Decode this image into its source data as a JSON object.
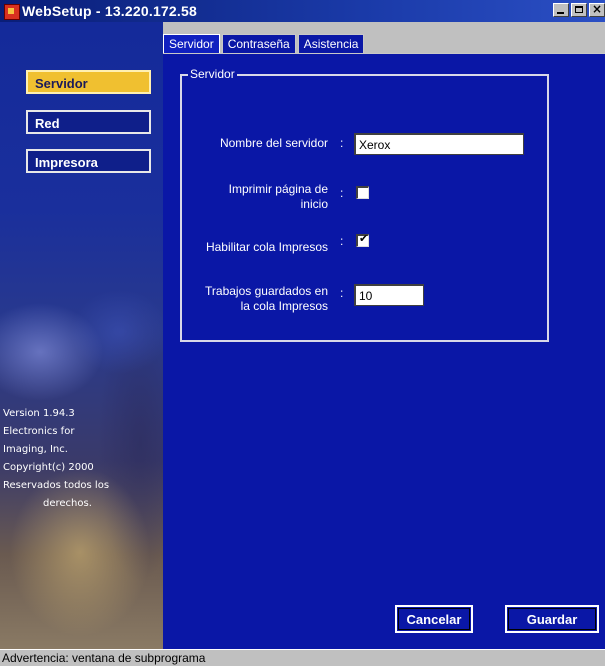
{
  "window": {
    "title": "WebSetup - 13.220.172.58",
    "controls": [
      "minimize",
      "maximize",
      "close"
    ]
  },
  "sidebar": {
    "items": [
      {
        "label": "Servidor",
        "active": true
      },
      {
        "label": "Red",
        "active": false
      },
      {
        "label": "Impresora",
        "active": false
      }
    ],
    "version_lines": [
      "Version 1.94.3",
      "Electronics for",
      "Imaging, Inc.",
      "Copyright(c) 2000",
      "Reservados todos los",
      "derechos."
    ]
  },
  "tabs": [
    {
      "label": "Servidor",
      "active": true
    },
    {
      "label": "Contraseña",
      "active": false
    },
    {
      "label": "Asistencia",
      "active": false
    }
  ],
  "group": {
    "title": "Servidor",
    "fields": {
      "server_name": {
        "label": "Nombre del servidor",
        "value": "Xerox"
      },
      "print_start_page": {
        "label_line1": "Imprimir página de",
        "label_line2": "inicio",
        "checked": false
      },
      "enable_print_queue": {
        "label": "Habilitar cola Impresos",
        "checked": true
      },
      "saved_jobs": {
        "label_line1": "Trabajos guardados en",
        "label_line2": "la cola Impresos",
        "value": "10"
      }
    },
    "colon": ":"
  },
  "buttons": {
    "cancel": "Cancelar",
    "save": "Guardar"
  },
  "status_bar": {
    "text": "Advertencia: ventana de subprograma"
  },
  "colors": {
    "panel_bg": "#0a17a6",
    "active_nav": "#f0c030",
    "titlebar": "#0a1e78"
  }
}
